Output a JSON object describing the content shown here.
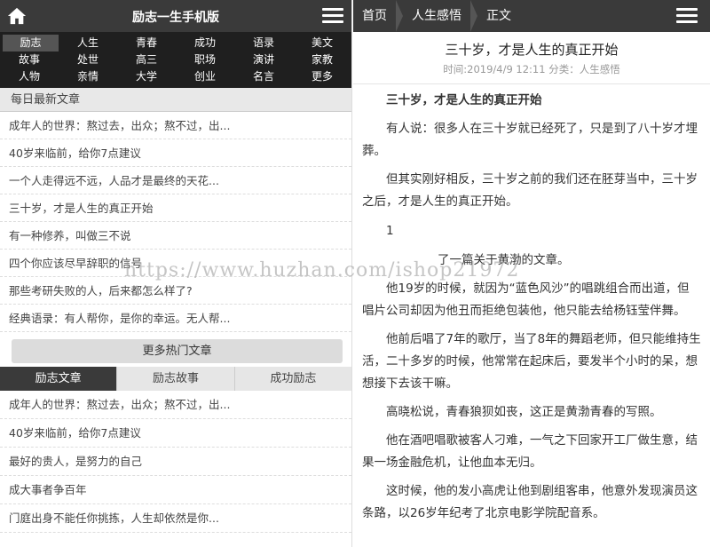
{
  "left": {
    "header_title": "励志一生手机版",
    "categories": [
      [
        "励志",
        "人生",
        "青春",
        "成功",
        "语录",
        "美文"
      ],
      [
        "故事",
        "处世",
        "高三",
        "职场",
        "演讲",
        "家教"
      ],
      [
        "人物",
        "亲情",
        "大学",
        "创业",
        "名言",
        "更多"
      ]
    ],
    "latest_title": "每日最新文章",
    "latest_articles": [
      "成年人的世界：熬过去，出众；熬不过，出...",
      "40岁来临前，给你7点建议",
      "一个人走得远不远，人品才是最终的天花...",
      "三十岁，才是人生的真正开始",
      "有一种修养，叫做三不说",
      "四个你应该尽早辞职的信号",
      "那些考研失败的人，后来都怎么样了?",
      "经典语录：有人帮你，是你的幸运。无人帮..."
    ],
    "more_button": "更多热门文章",
    "tabs": [
      "励志文章",
      "励志故事",
      "成功励志"
    ],
    "tab_articles": [
      "成年人的世界：熬过去，出众；熬不过，出...",
      "40岁来临前，给你7点建议",
      "最好的贵人，是努力的自己",
      "成大事者争百年",
      "门庭出身不能任你挑拣，人生却依然是你..."
    ]
  },
  "right": {
    "breadcrumb": [
      "首页",
      "人生感悟",
      "正文"
    ],
    "article_title": "三十岁，才是人生的真正开始",
    "meta": "时间:2019/4/9 12:11 分类：人生感悟",
    "paragraphs": [
      {
        "style": "strong",
        "text": "三十岁，才是人生的真正开始"
      },
      {
        "style": "normal",
        "text": "有人说：很多人在三十岁就已经死了，只是到了八十岁才埋葬。"
      },
      {
        "style": "normal",
        "text": "但其实刚好相反，三十岁之前的我们还在胚芽当中，三十岁之后，才是人生的真正开始。"
      },
      {
        "style": "num",
        "text": "1"
      },
      {
        "style": "mid",
        "text": "了一篇关于黄渤的文章。"
      },
      {
        "style": "normal",
        "text": "他19岁的时候，就因为“蓝色风沙”的唱跳组合而出道，但唱片公司却因为他丑而拒绝包装他，他只能去给杨钰莹伴舞。"
      },
      {
        "style": "normal",
        "text": "他前后唱了7年的歌厅，当了8年的舞蹈老师，但只能维持生活，二十多岁的时候，他常常在起床后，要发半个小时的呆，想想接下去该干嘛。"
      },
      {
        "style": "normal",
        "text": "高晓松说，青春狼狈如丧，这正是黄渤青春的写照。"
      },
      {
        "style": "normal",
        "text": "他在酒吧唱歌被客人刁难，一气之下回家开工厂做生意，结果一场金融危机，让他血本无归。"
      },
      {
        "style": "normal",
        "text": "这时候，他的发小高虎让他到剧组客串，他意外发现演员这条路，以26岁年纪考了北京电影学院配音系。"
      }
    ]
  },
  "watermark": "https://www.huzhan.com/ishop21972"
}
